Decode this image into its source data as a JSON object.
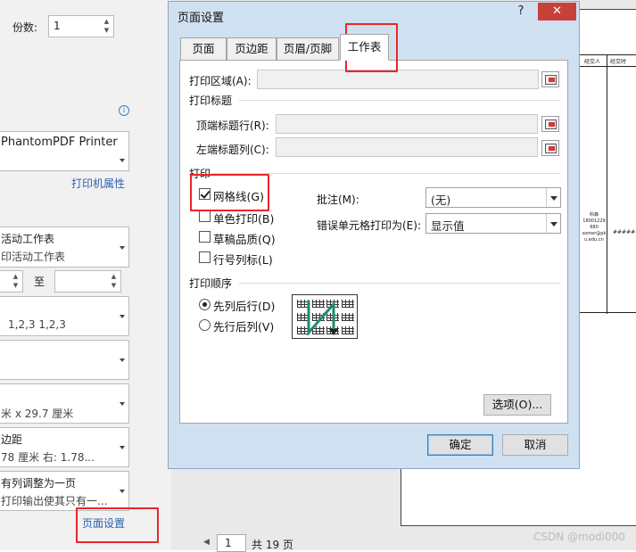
{
  "left_panel": {
    "copies_label": "份数:",
    "copies_value": "1",
    "printer_name": "PhantomPDF Printer",
    "printer_properties": "打印机属性",
    "sheets_line1": "活动工作表",
    "sheets_line2": "印活动工作表",
    "range_to": "至",
    "collate_line": "1,2,3    1,2,3",
    "paper_line": "米 x 29.7 厘米",
    "margins_line1": "边距",
    "margins_line2": "78 厘米   右: 1.78...",
    "scaling_line1": "有列调整为一页",
    "scaling_line2": "打印输出使其只有一...",
    "page_setup_link": "页面设置"
  },
  "preview": {
    "col_header_1": "经交人",
    "col_header_2": "经交时",
    "cell_text": "科森\n18001229\n680\nsomer@pk\nu.edu.cn",
    "cell_hash": "######",
    "current_page": "1",
    "total_pages": "共 19 页",
    "watermark": "CSDN @modi000"
  },
  "dialog": {
    "title": "页面设置",
    "help": "?",
    "close": "✕",
    "tabs": [
      {
        "label": "页面"
      },
      {
        "label": "页边距"
      },
      {
        "label": "页眉/页脚"
      },
      {
        "label": "工作表"
      }
    ],
    "print_area_label": "打印区域(A):",
    "print_titles_title": "打印标题",
    "top_rows_label": "顶端标题行(R):",
    "left_cols_label": "左端标题列(C):",
    "print_section_title": "打印",
    "gridlines_label": "网格线(G)",
    "gridlines_checked": true,
    "mono_label": "单色打印(B)",
    "draft_label": "草稿品质(Q)",
    "rowcol_label": "行号列标(L)",
    "comments_label": "批注(M):",
    "comments_value": "(无)",
    "errors_label": "错误单元格打印为(E):",
    "errors_value": "显示值",
    "order_title": "打印顺序",
    "down_then_over": "先列后行(D)",
    "over_then_down": "先行后列(V)",
    "options_button": "选项(O)...",
    "ok_button": "确定",
    "cancel_button": "取消"
  },
  "colors": {
    "highlight": "#e8262b",
    "link": "#2a62b2",
    "dialog_frame": "#cfe0f1",
    "close_button": "#c7413a"
  }
}
